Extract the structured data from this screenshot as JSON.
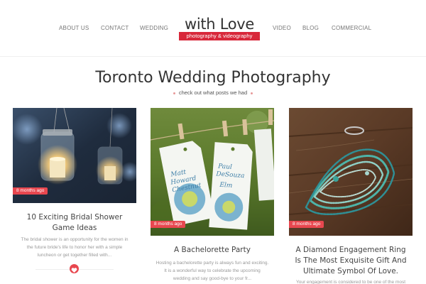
{
  "nav": {
    "left": [
      "ABOUT US",
      "CONTACT",
      "WEDDING"
    ],
    "right": [
      "VIDEO",
      "BLOG",
      "COMMERCIAL"
    ]
  },
  "logo": {
    "title": "with Love",
    "subtitle": "photography & videography",
    "brand_color": "#d8283a"
  },
  "section": {
    "title": "Toronto Wedding Photography",
    "subtitle": "check out what posts we had"
  },
  "posts": [
    {
      "badge": "8 months ago",
      "title_lines": [
        "10 Exciting Bridal Shower",
        "Game Ideas"
      ],
      "excerpt_lines": [
        "The bridal shower is an opportunity for the women in",
        "the future bride's life to honor her with a simple",
        "luncheon or get together filled with..."
      ],
      "image": "mason-jar-lanterns"
    },
    {
      "badge": "8 months ago",
      "title_lines": [
        "A Bachelorette Party"
      ],
      "excerpt_lines": [
        "Hosting a bachelorette party is always fun and exciting.",
        "It is a wonderful way to celebrate the upcoming",
        "wedding and say good-bye to your fr..."
      ],
      "image": "name-tags-on-string",
      "tag_text": [
        "Matt",
        "Howard",
        "Chestnut",
        "Paul",
        "DeSouza",
        "Elm"
      ]
    },
    {
      "badge": "8 months ago",
      "title_lines": [
        "A Diamond Engagement Ring",
        "Is The Most Exquisite Gift And",
        "Ultimate Symbol Of Love."
      ],
      "excerpt_lines": [
        "Your engagement is considered to be one of the most"
      ],
      "image": "turquoise-necklaces-on-wood"
    }
  ],
  "colors": {
    "accent": "#e8474f",
    "text": "#444444",
    "muted": "#999999"
  }
}
